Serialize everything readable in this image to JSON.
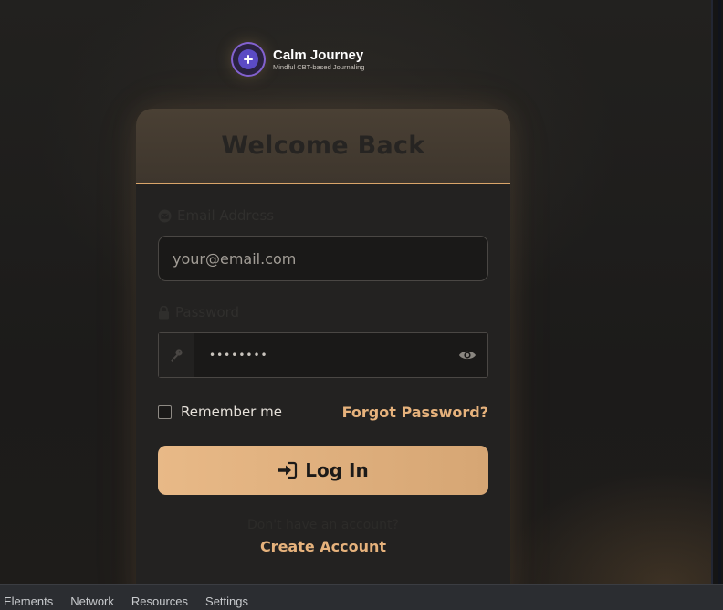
{
  "app": {
    "name": "Calm Journey",
    "tagline": "Mindful CBT-based Journaling"
  },
  "card": {
    "title": "Welcome Back"
  },
  "email": {
    "label": "Email Address",
    "placeholder": "your@email.com",
    "icon": "envelope-icon"
  },
  "password": {
    "label": "Password",
    "value": "••••••••",
    "icon": "lock-icon",
    "prefix_icon": "key-icon",
    "toggle_icon": "eye-icon"
  },
  "remember": {
    "label": "Remember me",
    "checked": false
  },
  "forgot": {
    "label": "Forgot Password?"
  },
  "login": {
    "label": "Log In",
    "icon": "sign-in-icon"
  },
  "signup": {
    "prompt": "Don't have an account?",
    "link": "Create Account"
  },
  "devtools": {
    "tabs": [
      "Elements",
      "Network",
      "Resources",
      "Settings"
    ]
  },
  "colors": {
    "accent": "#e6b27c",
    "button": "#e0b27f",
    "logo_ring": "#7a5ae0",
    "card_header": "#45392f"
  }
}
